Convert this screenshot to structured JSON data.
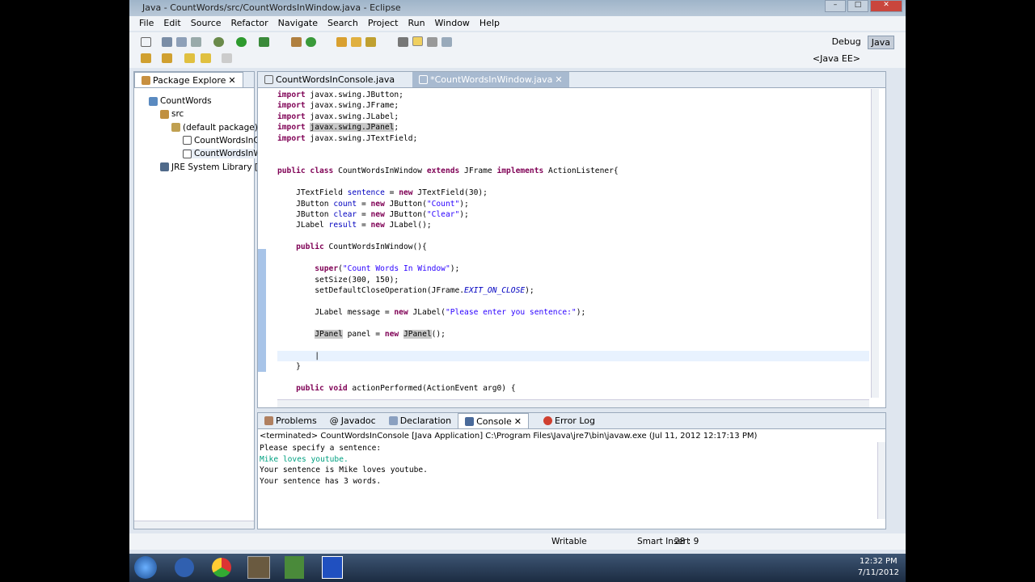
{
  "window": {
    "title": "Java - CountWords/src/CountWordsInWindow.java - Eclipse"
  },
  "menu": [
    "File",
    "Edit",
    "Source",
    "Refactor",
    "Navigate",
    "Search",
    "Project",
    "Run",
    "Window",
    "Help"
  ],
  "perspectives": {
    "debug": "Debug",
    "java": "Java",
    "java_ee": "<Java EE>"
  },
  "package_explorer": {
    "tab": "Package Explore",
    "tree": [
      {
        "label": "CountWords",
        "level": 0
      },
      {
        "label": "src",
        "level": 1
      },
      {
        "label": "(default package)",
        "level": 2
      },
      {
        "label": "CountWordsInCor",
        "level": 3
      },
      {
        "label": "CountWordsInWin",
        "level": 3,
        "selected": true
      },
      {
        "label": "JRE System Library [JavaSE",
        "level": 1
      }
    ]
  },
  "editor": {
    "tabs": [
      {
        "label": "CountWordsInConsole.java"
      },
      {
        "label": "*CountWordsInWindow.java"
      }
    ],
    "lines": [
      [
        [
          "import",
          "kw"
        ],
        [
          " javax.swing.JButton;",
          ""
        ]
      ],
      [
        [
          "import",
          "kw"
        ],
        [
          " javax.swing.JFrame;",
          ""
        ]
      ],
      [
        [
          "import",
          "kw"
        ],
        [
          " javax.swing.JLabel;",
          ""
        ]
      ],
      [
        [
          "import",
          "kw"
        ],
        [
          " ",
          ""
        ],
        [
          "javax.swing.JPanel",
          "hl"
        ],
        [
          ";",
          ""
        ]
      ],
      [
        [
          "import",
          "kw"
        ],
        [
          " javax.swing.JTextField;",
          ""
        ]
      ],
      [],
      [],
      [
        [
          "public class",
          "kw"
        ],
        [
          " CountWordsInWindow ",
          ""
        ],
        [
          "extends",
          "kw"
        ],
        [
          " JFrame ",
          ""
        ],
        [
          "implements",
          "kw"
        ],
        [
          " ActionListener{",
          ""
        ]
      ],
      [],
      [
        [
          "    JTextField ",
          ""
        ],
        [
          "sentence",
          "fld"
        ],
        [
          " = ",
          ""
        ],
        [
          "new",
          "kw"
        ],
        [
          " JTextField(30);",
          ""
        ]
      ],
      [
        [
          "    JButton ",
          ""
        ],
        [
          "count",
          "fld"
        ],
        [
          " = ",
          ""
        ],
        [
          "new",
          "kw"
        ],
        [
          " JButton(",
          ""
        ],
        [
          "\"Count\"",
          "str"
        ],
        [
          ");",
          ""
        ]
      ],
      [
        [
          "    JButton ",
          ""
        ],
        [
          "clear",
          "fld"
        ],
        [
          " = ",
          ""
        ],
        [
          "new",
          "kw"
        ],
        [
          " JButton(",
          ""
        ],
        [
          "\"Clear\"",
          "str"
        ],
        [
          ");",
          ""
        ]
      ],
      [
        [
          "    JLabel ",
          ""
        ],
        [
          "result",
          "fld"
        ],
        [
          " = ",
          ""
        ],
        [
          "new",
          "kw"
        ],
        [
          " JLabel();",
          ""
        ]
      ],
      [],
      [
        [
          "    ",
          ""
        ],
        [
          "public",
          "kw"
        ],
        [
          " CountWordsInWindow(){",
          ""
        ]
      ],
      [],
      [
        [
          "        ",
          ""
        ],
        [
          "super",
          "kw"
        ],
        [
          "(",
          ""
        ],
        [
          "\"Count Words In Window\"",
          "str"
        ],
        [
          ");",
          ""
        ]
      ],
      [
        [
          "        setSize(300, 150);",
          ""
        ]
      ],
      [
        [
          "        setDefaultCloseOperation(JFrame.",
          ""
        ],
        [
          "EXIT_ON_CLOSE",
          "it"
        ],
        [
          ");",
          ""
        ]
      ],
      [],
      [
        [
          "        JLabel message = ",
          ""
        ],
        [
          "new",
          "kw"
        ],
        [
          " JLabel(",
          ""
        ],
        [
          "\"Please enter you sentence:\"",
          "str"
        ],
        [
          ");",
          ""
        ]
      ],
      [],
      [
        [
          "        ",
          ""
        ],
        [
          "JPanel",
          "hl"
        ],
        [
          " panel = ",
          ""
        ],
        [
          "new",
          "kw"
        ],
        [
          " ",
          ""
        ],
        [
          "JPanel",
          "hl"
        ],
        [
          "();",
          ""
        ]
      ],
      [],
      [
        [
          "        |",
          ""
        ]
      ],
      [
        [
          "    }",
          ""
        ]
      ],
      [],
      [
        [
          "    ",
          ""
        ],
        [
          "public void",
          "kw"
        ],
        [
          " actionPerformed(ActionEvent arg0) {",
          ""
        ]
      ]
    ]
  },
  "bottom": {
    "tabs": [
      "Problems",
      "Javadoc",
      "Declaration",
      "Console",
      "Error Log"
    ],
    "active": "Console",
    "console_header": "<terminated> CountWordsInConsole [Java Application] C:\\Program Files\\Java\\jre7\\bin\\javaw.exe (Jul 11, 2012 12:17:13 PM)",
    "output": [
      {
        "text": "Please specify a sentence:",
        "input": false
      },
      {
        "text": "Mike loves youtube.",
        "input": true
      },
      {
        "text": "Your sentence is Mike loves youtube.",
        "input": false
      },
      {
        "text": "Your sentence has 3 words.",
        "input": false
      }
    ]
  },
  "status": {
    "mode": "Writable",
    "insert": "Smart Insert",
    "position": "28 : 9"
  },
  "taskbar": {
    "time": "12:32 PM",
    "date": "7/11/2012"
  }
}
